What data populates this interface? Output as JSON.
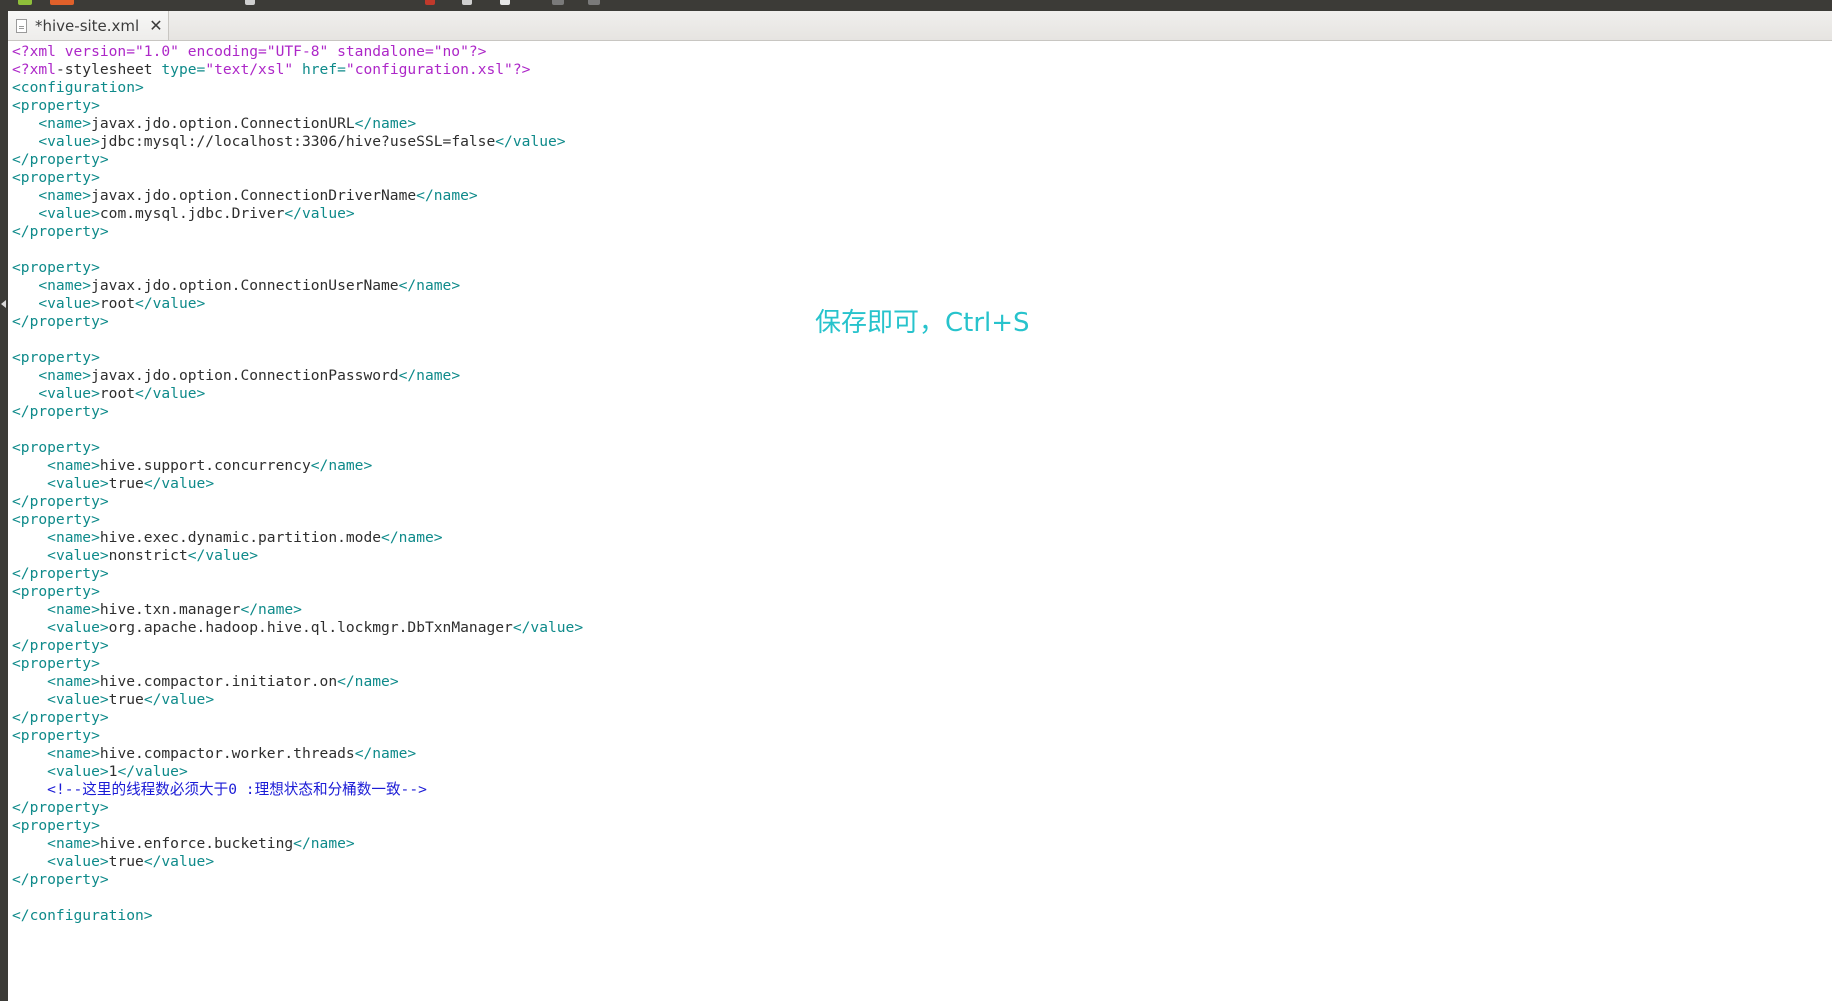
{
  "tab": {
    "title": "*hive-site.xml",
    "close_glyph": "✕"
  },
  "annotation": "保存即可，Ctrl+S",
  "colors": {
    "processing_instruction": "#ad27c8",
    "tag": "#0e8a8a",
    "text": "#2e2e2e",
    "comment": "#1b1bd6",
    "annotation": "#27c3cc"
  },
  "lines": [
    [
      {
        "c": "pi",
        "t": "<?xml version=\"1.0\" encoding=\"UTF-8\" standalone=\"no\"?>"
      }
    ],
    [
      {
        "c": "pi",
        "t": "<?xml"
      },
      {
        "c": "text",
        "t": "-stylesheet "
      },
      {
        "c": "tag",
        "t": "type="
      },
      {
        "c": "attrv",
        "t": "\"text/xsl\""
      },
      {
        "c": "tag",
        "t": " href="
      },
      {
        "c": "attrv",
        "t": "\"configuration.xsl\""
      },
      {
        "c": "pi",
        "t": "?>"
      }
    ],
    [
      {
        "c": "tag",
        "t": "<configuration>"
      }
    ],
    [
      {
        "c": "tag",
        "t": "<property>"
      }
    ],
    [
      {
        "c": "text",
        "t": "   "
      },
      {
        "c": "tag",
        "t": "<name>"
      },
      {
        "c": "text",
        "t": "javax.jdo.option.ConnectionURL"
      },
      {
        "c": "tag",
        "t": "</name>"
      }
    ],
    [
      {
        "c": "text",
        "t": "   "
      },
      {
        "c": "tag",
        "t": "<value>"
      },
      {
        "c": "text",
        "t": "jdbc:mysql://localhost:3306/hive?useSSL=false"
      },
      {
        "c": "tag",
        "t": "</value>"
      }
    ],
    [
      {
        "c": "tag",
        "t": "</property>"
      }
    ],
    [
      {
        "c": "tag",
        "t": "<property>"
      }
    ],
    [
      {
        "c": "text",
        "t": "   "
      },
      {
        "c": "tag",
        "t": "<name>"
      },
      {
        "c": "text",
        "t": "javax.jdo.option.ConnectionDriverName"
      },
      {
        "c": "tag",
        "t": "</name>"
      }
    ],
    [
      {
        "c": "text",
        "t": "   "
      },
      {
        "c": "tag",
        "t": "<value>"
      },
      {
        "c": "text",
        "t": "com.mysql.jdbc.Driver"
      },
      {
        "c": "tag",
        "t": "</value>"
      }
    ],
    [
      {
        "c": "tag",
        "t": "</property>"
      }
    ],
    [],
    [
      {
        "c": "tag",
        "t": "<property>"
      }
    ],
    [
      {
        "c": "text",
        "t": "   "
      },
      {
        "c": "tag",
        "t": "<name>"
      },
      {
        "c": "text",
        "t": "javax.jdo.option.ConnectionUserName"
      },
      {
        "c": "tag",
        "t": "</name>"
      }
    ],
    [
      {
        "c": "text",
        "t": "   "
      },
      {
        "c": "tag",
        "t": "<value>"
      },
      {
        "c": "text",
        "t": "root"
      },
      {
        "c": "tag",
        "t": "</value>"
      }
    ],
    [
      {
        "c": "tag",
        "t": "</property>"
      }
    ],
    [],
    [
      {
        "c": "tag",
        "t": "<property>"
      }
    ],
    [
      {
        "c": "text",
        "t": "   "
      },
      {
        "c": "tag",
        "t": "<name>"
      },
      {
        "c": "text",
        "t": "javax.jdo.option.ConnectionPassword"
      },
      {
        "c": "tag",
        "t": "</name>"
      }
    ],
    [
      {
        "c": "text",
        "t": "   "
      },
      {
        "c": "tag",
        "t": "<value>"
      },
      {
        "c": "text",
        "t": "root"
      },
      {
        "c": "tag",
        "t": "</value>"
      }
    ],
    [
      {
        "c": "tag",
        "t": "</property>"
      }
    ],
    [],
    [
      {
        "c": "tag",
        "t": "<property>"
      }
    ],
    [
      {
        "c": "text",
        "t": "    "
      },
      {
        "c": "tag",
        "t": "<name>"
      },
      {
        "c": "text",
        "t": "hive.support.concurrency"
      },
      {
        "c": "tag",
        "t": "</name>"
      }
    ],
    [
      {
        "c": "text",
        "t": "    "
      },
      {
        "c": "tag",
        "t": "<value>"
      },
      {
        "c": "text",
        "t": "true"
      },
      {
        "c": "tag",
        "t": "</value>"
      }
    ],
    [
      {
        "c": "tag",
        "t": "</property>"
      }
    ],
    [
      {
        "c": "tag",
        "t": "<property>"
      }
    ],
    [
      {
        "c": "text",
        "t": "    "
      },
      {
        "c": "tag",
        "t": "<name>"
      },
      {
        "c": "text",
        "t": "hive.exec.dynamic.partition.mode"
      },
      {
        "c": "tag",
        "t": "</name>"
      }
    ],
    [
      {
        "c": "text",
        "t": "    "
      },
      {
        "c": "tag",
        "t": "<value>"
      },
      {
        "c": "text",
        "t": "nonstrict"
      },
      {
        "c": "tag",
        "t": "</value>"
      }
    ],
    [
      {
        "c": "tag",
        "t": "</property>"
      }
    ],
    [
      {
        "c": "tag",
        "t": "<property>"
      }
    ],
    [
      {
        "c": "text",
        "t": "    "
      },
      {
        "c": "tag",
        "t": "<name>"
      },
      {
        "c": "text",
        "t": "hive.txn.manager"
      },
      {
        "c": "tag",
        "t": "</name>"
      }
    ],
    [
      {
        "c": "text",
        "t": "    "
      },
      {
        "c": "tag",
        "t": "<value>"
      },
      {
        "c": "text",
        "t": "org.apache.hadoop.hive.ql.lockmgr.DbTxnManager"
      },
      {
        "c": "tag",
        "t": "</value>"
      }
    ],
    [
      {
        "c": "tag",
        "t": "</property>"
      }
    ],
    [
      {
        "c": "tag",
        "t": "<property>"
      }
    ],
    [
      {
        "c": "text",
        "t": "    "
      },
      {
        "c": "tag",
        "t": "<name>"
      },
      {
        "c": "text",
        "t": "hive.compactor.initiator.on"
      },
      {
        "c": "tag",
        "t": "</name>"
      }
    ],
    [
      {
        "c": "text",
        "t": "    "
      },
      {
        "c": "tag",
        "t": "<value>"
      },
      {
        "c": "text",
        "t": "true"
      },
      {
        "c": "tag",
        "t": "</value>"
      }
    ],
    [
      {
        "c": "tag",
        "t": "</property>"
      }
    ],
    [
      {
        "c": "tag",
        "t": "<property>"
      }
    ],
    [
      {
        "c": "text",
        "t": "    "
      },
      {
        "c": "tag",
        "t": "<name>"
      },
      {
        "c": "text",
        "t": "hive.compactor.worker.threads"
      },
      {
        "c": "tag",
        "t": "</name>"
      }
    ],
    [
      {
        "c": "text",
        "t": "    "
      },
      {
        "c": "tag",
        "t": "<value>"
      },
      {
        "c": "text",
        "t": "1"
      },
      {
        "c": "tag",
        "t": "</value>"
      }
    ],
    [
      {
        "c": "text",
        "t": "    "
      },
      {
        "c": "comment",
        "t": "<!--这里的线程数必须大于0 :理想状态和分桶数一致-->"
      }
    ],
    [
      {
        "c": "tag",
        "t": "</property>"
      }
    ],
    [
      {
        "c": "tag",
        "t": "<property>"
      }
    ],
    [
      {
        "c": "text",
        "t": "    "
      },
      {
        "c": "tag",
        "t": "<name>"
      },
      {
        "c": "text",
        "t": "hive.enforce.bucketing"
      },
      {
        "c": "tag",
        "t": "</name>"
      }
    ],
    [
      {
        "c": "text",
        "t": "    "
      },
      {
        "c": "tag",
        "t": "<value>"
      },
      {
        "c": "text",
        "t": "true"
      },
      {
        "c": "tag",
        "t": "</value>"
      }
    ],
    [
      {
        "c": "tag",
        "t": "</property>"
      }
    ],
    [],
    [
      {
        "c": "tag",
        "t": "</configuration>"
      }
    ]
  ]
}
